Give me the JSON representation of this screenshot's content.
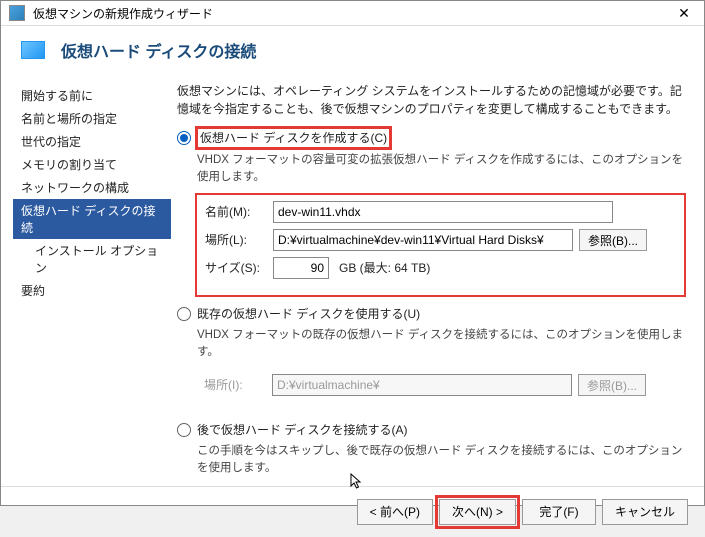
{
  "window": {
    "title": "仮想マシンの新規作成ウィザード",
    "close": "✕"
  },
  "header": {
    "title": "仮想ハード ディスクの接続"
  },
  "sidebar": {
    "items": [
      {
        "label": "開始する前に"
      },
      {
        "label": "名前と場所の指定"
      },
      {
        "label": "世代の指定"
      },
      {
        "label": "メモリの割り当て"
      },
      {
        "label": "ネットワークの構成"
      },
      {
        "label": "仮想ハード ディスクの接続",
        "selected": true
      },
      {
        "label": "インストール オプション",
        "indent": true
      },
      {
        "label": "要約"
      }
    ]
  },
  "content": {
    "description": "仮想マシンには、オペレーティング システムをインストールするための記憶域が必要です。記憶域を今指定することも、後で仮想マシンのプロパティを変更して構成することもできます。",
    "opt1": {
      "label": "仮想ハード ディスクを作成する(C)",
      "sub": "VHDX フォーマットの容量可変の拡張仮想ハード ディスクを作成するには、このオプションを使用します。",
      "form": {
        "name_label": "名前(M):",
        "name_value": "dev-win11.vhdx",
        "loc_label": "場所(L):",
        "loc_value": "D:¥virtualmachine¥dev-win11¥Virtual Hard Disks¥",
        "browse": "参照(B)...",
        "size_label": "サイズ(S):",
        "size_value": "90",
        "size_unit": "GB (最大: 64 TB)"
      }
    },
    "opt2": {
      "label": "既存の仮想ハード ディスクを使用する(U)",
      "sub": "VHDX フォーマットの既存の仮想ハード ディスクを接続するには、このオプションを使用します。",
      "form": {
        "loc_label": "場所(I):",
        "loc_value": "D:¥virtualmachine¥",
        "browse": "参照(B)..."
      }
    },
    "opt3": {
      "label": "後で仮想ハード ディスクを接続する(A)",
      "sub": "この手順を今はスキップし、後で既存の仮想ハード ディスクを接続するには、このオプションを使用します。"
    }
  },
  "footer": {
    "prev": "< 前へ(P)",
    "next": "次へ(N) >",
    "finish": "完了(F)",
    "cancel": "キャンセル"
  }
}
